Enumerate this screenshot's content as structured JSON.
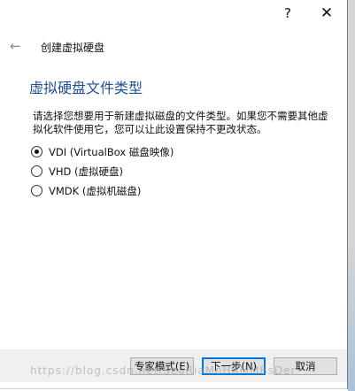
{
  "titlebar": {
    "help_label": "?",
    "close_label": "✕"
  },
  "wizard": {
    "title": "创建虚拟硬盘",
    "heading": "虚拟硬盘文件类型",
    "description": "请选择您想要用于新建虚拟磁盘的文件类型。如果您不需要其他虚拟化软件使用它，您可以让此设置保持不更改状态。"
  },
  "options": [
    {
      "label": "VDI (VirtualBox 磁盘映像)",
      "selected": true
    },
    {
      "label": "VHD (虚拟硬盘)",
      "selected": false
    },
    {
      "label": "VMDK (虚拟机磁盘)",
      "selected": false
    }
  ],
  "buttons": {
    "expert_label": "专家模式(E)",
    "next_label": "下一步(N)",
    "cancel_label": "取消"
  },
  "watermark": "https://blog.csdn.net/SeaRiaMoHAMMBsDer",
  "icons": {
    "back": "back-arrow-icon",
    "help": "help-icon",
    "close": "close-icon"
  }
}
